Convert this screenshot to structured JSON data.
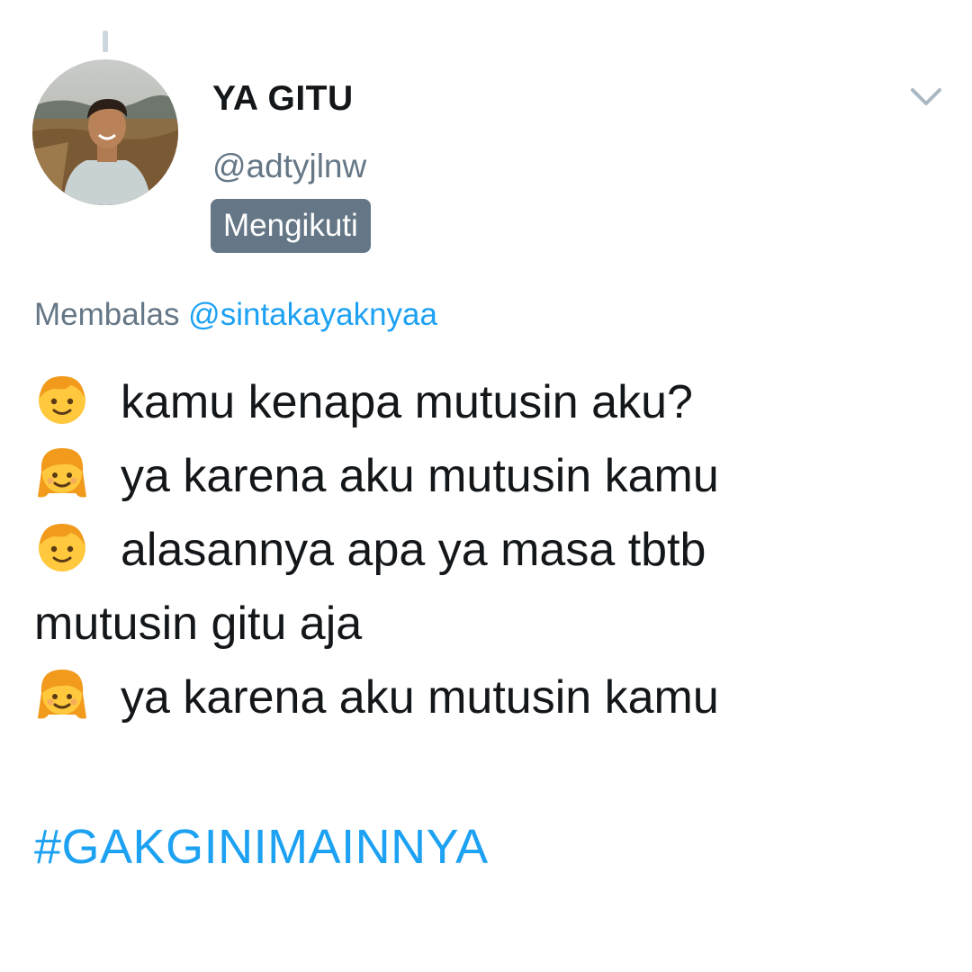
{
  "author": {
    "display_name": "YA GITU",
    "handle": "@adtyjlnw",
    "follows_badge": "Mengikuti"
  },
  "reply_context": {
    "prefix": "Membalas ",
    "mention": "@sintakayaknyaa"
  },
  "tweet": {
    "lines": [
      {
        "emoji": "boy-emoji",
        "text": "kamu kenapa mutusin aku?"
      },
      {
        "emoji": "girl-emoji",
        "text": "ya karena aku mutusin kamu"
      },
      {
        "emoji": "boy-emoji",
        "text": "alasannya apa ya masa tbtb"
      },
      {
        "emoji": "",
        "text": "mutusin gitu aja"
      },
      {
        "emoji": "girl-emoji",
        "text": "ya karena aku mutusin kamu"
      }
    ],
    "hashtag": "#GAKGINIMAINNYA"
  },
  "icons": {
    "menu": "chevron-down-icon"
  },
  "colors": {
    "text": "#14171a",
    "secondary": "#657786",
    "link": "#1da1f2",
    "emoji_face": "#ffc83d",
    "emoji_hair": "#f19a1c"
  }
}
